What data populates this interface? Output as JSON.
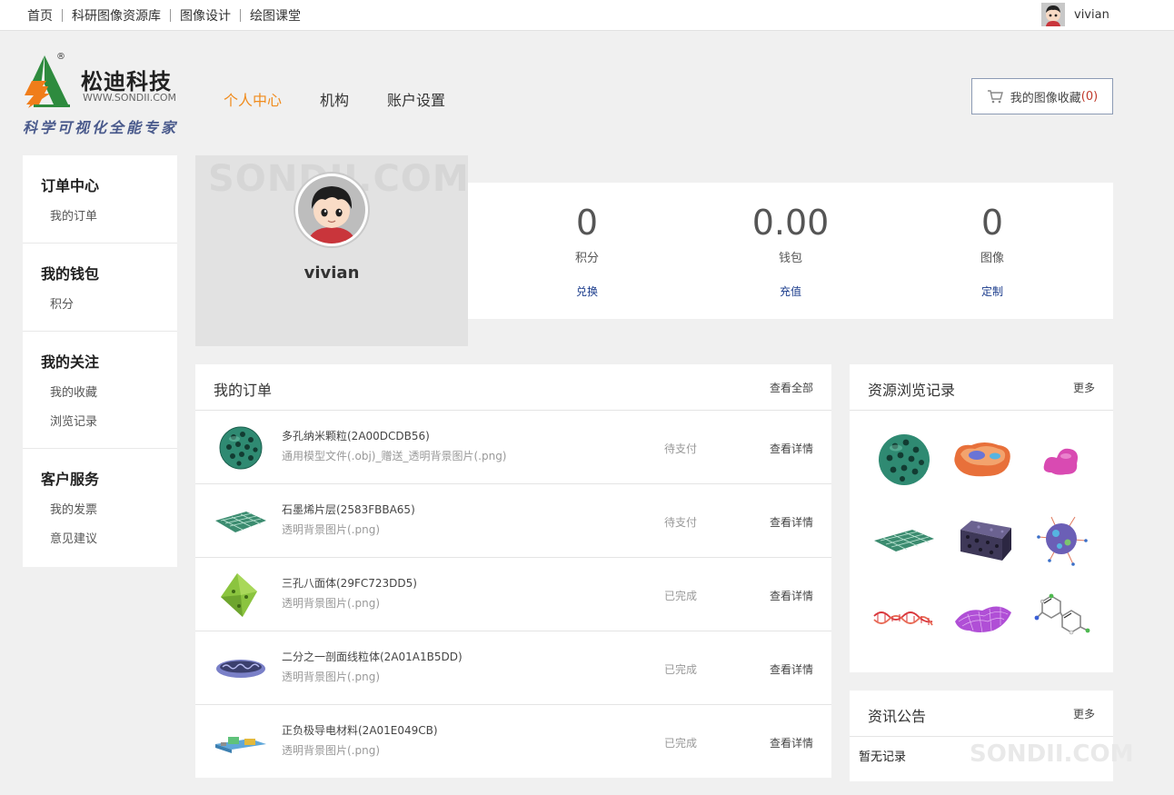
{
  "topbar": {
    "links": [
      "首页",
      "科研图像资源库",
      "图像设计",
      "绘图课堂"
    ],
    "username": "vivian"
  },
  "logo": {
    "brand": "松迪科技",
    "domain": "WWW.SONDII.COM",
    "registered": "®",
    "slogan": "科学可视化全能专家"
  },
  "mainnav": {
    "items": [
      "个人中心",
      "机构",
      "账户设置"
    ],
    "active_index": 0
  },
  "favorites": {
    "label": "我的图像收藏",
    "count_text": "(0)"
  },
  "sidebar": {
    "groups": [
      {
        "title": "订单中心",
        "items": [
          "我的订单"
        ]
      },
      {
        "title": "我的钱包",
        "items": [
          "积分"
        ]
      },
      {
        "title": "我的关注",
        "items": [
          "我的收藏",
          "浏览记录"
        ]
      },
      {
        "title": "客户服务",
        "items": [
          "我的发票",
          "意见建议"
        ]
      }
    ]
  },
  "profile": {
    "username": "vivian",
    "watermark": "SONDII.COM"
  },
  "stats": [
    {
      "value": "0",
      "label": "积分",
      "action": "兑换"
    },
    {
      "value": "0.00",
      "label": "钱包",
      "action": "充值"
    },
    {
      "value": "0",
      "label": "图像",
      "action": "定制"
    }
  ],
  "orders": {
    "title": "我的订单",
    "view_all": "查看全部",
    "rows": [
      {
        "name": "多孔纳米颗粒(2A00DCDB56)",
        "desc": "通用模型文件(.obj)_赠送_透明背景图片(.png)",
        "status": "待支付",
        "detail": "查看详情",
        "thumb": "porous-sphere"
      },
      {
        "name": "石墨烯片层(2583FBBA65)",
        "desc": "透明背景图片(.png)",
        "status": "待支付",
        "detail": "查看详情",
        "thumb": "graphene"
      },
      {
        "name": "三孔八面体(29FC723DD5)",
        "desc": "透明背景图片(.png)",
        "status": "已完成",
        "detail": "查看详情",
        "thumb": "octahedron"
      },
      {
        "name": "二分之一剖面线粒体(2A01A1B5DD)",
        "desc": "透明背景图片(.png)",
        "status": "已完成",
        "detail": "查看详情",
        "thumb": "mitochondria"
      },
      {
        "name": "正负极导电材料(2A01E049CB)",
        "desc": "透明背景图片(.png)",
        "status": "已完成",
        "detail": "查看详情",
        "thumb": "electrode"
      }
    ]
  },
  "history": {
    "title": "资源浏览记录",
    "more": "更多",
    "items": [
      "porous-sphere",
      "cell-section",
      "pink-blob",
      "graphene",
      "porous-block",
      "virus",
      "dna-helix",
      "purple-mesh",
      "molecule"
    ]
  },
  "news": {
    "title": "资讯公告",
    "more": "更多",
    "empty_text": "暂无记录",
    "watermark": "SONDII.COM"
  },
  "colors": {
    "accent": "#f08c1e",
    "link_blue": "#1b3c8c",
    "logo_green": "#2e8b3e",
    "logo_orange": "#f07d1a",
    "badge_red": "#c0392b"
  }
}
